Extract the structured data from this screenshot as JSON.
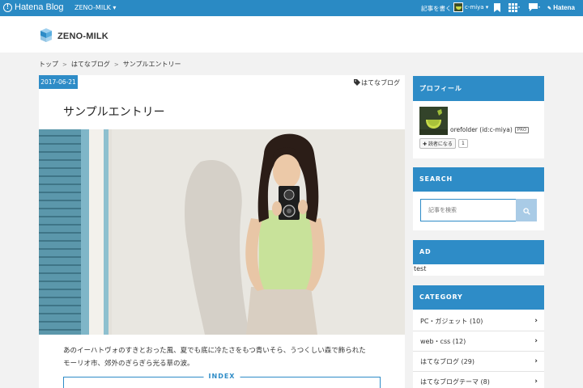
{
  "topbar": {
    "service_name": "Hatena Blog",
    "blog_selector": "ZENO-MILK ▾",
    "write_label": "記事を書く",
    "user_label": "c-miya ▾",
    "brand": "Hatena"
  },
  "header": {
    "site_title": "ZENO-MILK"
  },
  "breadcrumb": {
    "items": [
      "トップ",
      "はてなブログ",
      "サンプルエントリー"
    ],
    "separator": ">"
  },
  "article": {
    "date": "2017-06-21",
    "category": "はてなブログ",
    "title": "サンプルエントリー",
    "body_line1": "あのイーハトヴォのすきとおった風、夏でも底に冷たさをもつ青いそら、うつくしい森で飾られた",
    "body_line2": "モーリオ市、郊外のぎらぎら光る草の波。",
    "index_label": "INDEX"
  },
  "sidebar": {
    "profile": {
      "title": "プロフィール",
      "name": "orefolder (id:c-miya)",
      "pro_badge": "PRO",
      "reader_button": "✚ 読者になる",
      "reader_count": "1"
    },
    "search": {
      "title": "SEARCH",
      "placeholder": "記事を検索"
    },
    "ad": {
      "title": "AD",
      "text": "test"
    },
    "category": {
      "title": "CATEGORY",
      "items": [
        {
          "label": "PC・ガジェット (10)"
        },
        {
          "label": "web・css (12)"
        },
        {
          "label": "はてなブログ (29)"
        },
        {
          "label": "はてなブログテーマ (8)"
        }
      ]
    }
  },
  "colors": {
    "topbar": "#2a8ac4",
    "accent": "#2e8cc7",
    "page_background": "#f2f2f2"
  }
}
